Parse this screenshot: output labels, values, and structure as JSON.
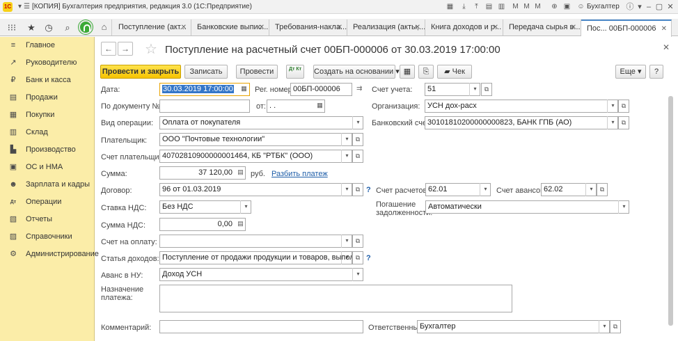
{
  "window": {
    "title": "[КОПИЯ] Бухгалтерия предприятия, редакция 3.0 (1С:Предприятие)",
    "user": "Бухгалтер",
    "logo": "1С"
  },
  "tabs": [
    {
      "label": "Поступление (акт..."
    },
    {
      "label": "Банковские выпис..."
    },
    {
      "label": "Требования-накла..."
    },
    {
      "label": "Реализация (акты,..."
    },
    {
      "label": "Книга доходов и р..."
    },
    {
      "label": "Передача сырья в..."
    },
    {
      "label": "Пос...   00БП-000006"
    }
  ],
  "sidebar": {
    "items": [
      {
        "label": "Главное",
        "icon": "≡"
      },
      {
        "label": "Руководителю",
        "icon": "↗"
      },
      {
        "label": "Банк и касса",
        "icon": "₽"
      },
      {
        "label": "Продажи",
        "icon": "▤"
      },
      {
        "label": "Покупки",
        "icon": "▦"
      },
      {
        "label": "Склад",
        "icon": "▥"
      },
      {
        "label": "Производство",
        "icon": "▙"
      },
      {
        "label": "ОС и НМА",
        "icon": "▣"
      },
      {
        "label": "Зарплата и кадры",
        "icon": "☻"
      },
      {
        "label": "Операции",
        "icon": "Дт"
      },
      {
        "label": "Отчеты",
        "icon": "▧"
      },
      {
        "label": "Справочники",
        "icon": "▨"
      },
      {
        "label": "Администрирование",
        "icon": "⚙"
      }
    ]
  },
  "document": {
    "title": "Поступление на расчетный счет 00БП-000006 от 30.03.2019 17:00:00"
  },
  "toolbar": {
    "post_close": "Провести и закрыть",
    "save": "Записать",
    "post": "Провести",
    "dt_kt": "Дт Кт",
    "create_based": "Создать на основании",
    "check": "Чек",
    "more": "Еще"
  },
  "form": {
    "date_label": "Дата:",
    "date_value": "30.03.2019 17:00:00",
    "reg_label": "Рег. номер:",
    "reg_value": "00БП-000006",
    "account_label": "Счет учета:",
    "account_value": "51",
    "doc_no_label": "По документу №:",
    "doc_no_value": "",
    "from_label": "от:",
    "from_value": " .  .",
    "org_label": "Организация:",
    "org_value": "УСН дох-расх",
    "op_label": "Вид операции:",
    "op_value": "Оплата от покупателя",
    "bank_acc_label": "Банковский счет:",
    "bank_acc_value": "30101810200000000823, БАНК ГПБ (АО)",
    "payer_label": "Плательщик:",
    "payer_value": "ООО \"Почтовые  технологии\"",
    "payer_acc_label": "Счет плательщика:",
    "payer_acc_value": "40702810900000001464, КБ \"РТБК\" (ООО)",
    "sum_label": "Сумма:",
    "sum_value": "37 120,00",
    "currency": "руб.",
    "split_link": "Разбить платеж",
    "contract_label": "Договор:",
    "contract_value": "96 от 01.03.2019",
    "settle_label": "Счет расчетов:",
    "settle_value": "62.01",
    "advance_label": "Счет авансов:",
    "advance_value": "62.02",
    "vat_rate_label": "Ставка НДС:",
    "vat_rate_value": "Без НДС",
    "repay_label1": "Погашение",
    "repay_label2": "задолженности:",
    "repay_value": "Автоматически",
    "vat_sum_label": "Сумма НДС:",
    "vat_sum_value": "0,00",
    "invoice_label": "Счет на оплату:",
    "invoice_value": "",
    "income_label": "Статья доходов:",
    "income_value": "Поступление от продажи продукции и товаров, выполнения",
    "adv_nu_label": "Аванс в НУ:",
    "adv_nu_value": "Доход УСН",
    "purpose_label1": "Назначение",
    "purpose_label2": "платежа:",
    "purpose_value": "",
    "comment_label": "Комментарий:",
    "comment_value": "",
    "resp_label": "Ответственный:",
    "resp_value": "Бухгалтер",
    "q": "?"
  }
}
